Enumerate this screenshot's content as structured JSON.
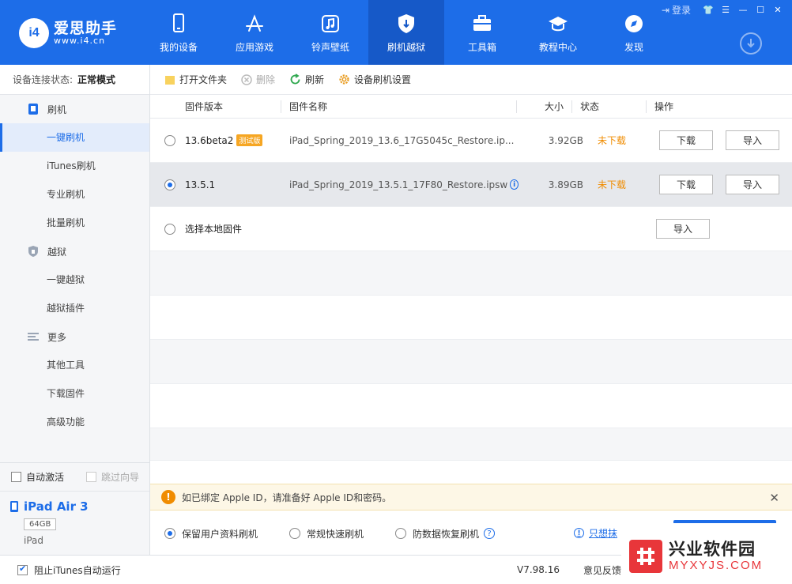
{
  "app": {
    "title": "爱思助手",
    "url": "www.i4.cn",
    "logo_mark": "i4"
  },
  "nav": [
    {
      "label": "我的设备",
      "icon": "phone-icon"
    },
    {
      "label": "应用游戏",
      "icon": "app-store-icon"
    },
    {
      "label": "铃声壁纸",
      "icon": "music-icon"
    },
    {
      "label": "刷机越狱",
      "icon": "shield-icon",
      "active": true
    },
    {
      "label": "工具箱",
      "icon": "toolbox-icon"
    },
    {
      "label": "教程中心",
      "icon": "graduation-cap-icon"
    },
    {
      "label": "发现",
      "icon": "compass-icon"
    }
  ],
  "window": {
    "login_label": "登录"
  },
  "sidebar": {
    "conn_label": "设备连接状态:",
    "conn_value": "正常模式",
    "groups": [
      {
        "label": "刷机",
        "icon": "flash-phone-icon",
        "items": [
          "一键刷机",
          "iTunes刷机",
          "专业刷机",
          "批量刷机"
        ]
      },
      {
        "label": "越狱",
        "icon": "jailbreak-shield-icon",
        "items": [
          "一键越狱",
          "越狱插件"
        ]
      },
      {
        "label": "更多",
        "icon": "menu-lines-icon",
        "items": [
          "其他工具",
          "下载固件",
          "高级功能"
        ]
      }
    ],
    "active_item": "一键刷机",
    "auto_activate": "自动激活",
    "skip_guide": "跳过向导",
    "device": {
      "name": "iPad Air 3",
      "capacity": "64GB",
      "type": "iPad"
    }
  },
  "toolbar": {
    "open_folder": "打开文件夹",
    "delete": "删除",
    "refresh": "刷新",
    "settings": "设备刷机设置"
  },
  "table": {
    "headers": [
      "固件版本",
      "固件名称",
      "大小",
      "状态",
      "操作"
    ],
    "rows": [
      {
        "version": "13.6beta2",
        "tag": "测试版",
        "name": "iPad_Spring_2019_13.6_17G5045c_Restore.ip...",
        "size": "3.92GB",
        "status": "未下载",
        "download": "下载",
        "import": "导入",
        "selected": false
      },
      {
        "version": "13.5.1",
        "tag": "",
        "name": "iPad_Spring_2019_13.5.1_17F80_Restore.ipsw",
        "size": "3.89GB",
        "status": "未下载",
        "download": "下载",
        "import": "导入",
        "selected": true
      }
    ],
    "local_label": "选择本地固件",
    "local_import": "导入"
  },
  "notice": {
    "text": "如已绑定 Apple ID，请准备好 Apple ID和密码。"
  },
  "modes": {
    "keep_data": "保留用户资料刷机",
    "quick": "常规快速刷机",
    "anti_recovery": "防数据恢复刷机",
    "only_erase": "只想抹"
  },
  "statusbar": {
    "itunes_block": "阻止iTunes自动运行",
    "version": "V7.98.16",
    "feedback": "意见反馈"
  },
  "watermark": {
    "cn": "兴业软件园",
    "en": "MYXYJS.COM"
  },
  "colors": {
    "brand": "#1d6de8",
    "warning": "#f08c00",
    "watermark": "#e8363a"
  }
}
